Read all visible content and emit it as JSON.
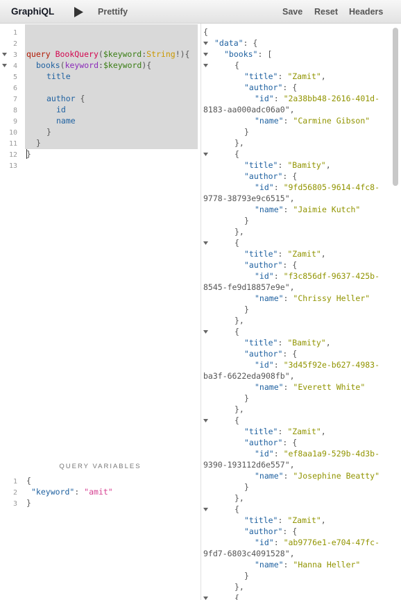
{
  "toolbar": {
    "app_title": "GraphiQL",
    "execute_icon": "play-icon",
    "prettify_label": "Prettify",
    "save_label": "Save",
    "reset_label": "Reset",
    "headers_label": "Headers"
  },
  "query_editor": {
    "line_numbers": [
      "1",
      "2",
      "3",
      "4",
      "5",
      "6",
      "7",
      "8",
      "9",
      "10",
      "11",
      "12",
      "13"
    ],
    "lines": {
      "l3_kw": "query",
      "l3_def": "BookQuery",
      "l3_p1": "(",
      "l3_var": "$keyword",
      "l3_colon": ":",
      "l3_type": "String",
      "l3_p2": "!){",
      "l4_field": "books",
      "l4_p1": "(",
      "l4_arg": "keyword",
      "l4_colon": ":",
      "l4_var": "$keyword",
      "l4_p2": "){",
      "l5_field": "title",
      "l7_field": "author",
      "l7_p": " {",
      "l8_field": "id",
      "l9_field": "name",
      "l10": "}",
      "l11": "}",
      "l12": "}"
    }
  },
  "variables": {
    "title": "QUERY VARIABLES",
    "line_numbers": [
      "1",
      "2",
      "3"
    ],
    "l1": "{",
    "l2_key": "\"keyword\"",
    "l2_colon": ": ",
    "l2_val": "\"amit\"",
    "l3": "}"
  },
  "result": {
    "open_brace": "{",
    "data_key": "\"data\"",
    "books_key": "\"books\"",
    "title_key": "\"title\"",
    "author_key": "\"author\"",
    "id_key": "\"id\"",
    "name_key": "\"name\"",
    "books": [
      {
        "title": "\"Zamit\"",
        "id_a": "\"2a38bb48-2616-401d-",
        "id_b": "8183-aa000adc06a0\"",
        "name": "\"Carmine Gibson\""
      },
      {
        "title": "\"Bamity\"",
        "id_a": "\"9fd56805-9614-4fc8-",
        "id_b": "9778-38793e9c6515\"",
        "name": "\"Jaimie Kutch\""
      },
      {
        "title": "\"Zamit\"",
        "id_a": "\"f3c856df-9637-425b-",
        "id_b": "8545-fe9d18857e9e\"",
        "name": "\"Chrissy Heller\""
      },
      {
        "title": "\"Bamity\"",
        "id_a": "\"3d45f92e-b627-4983-",
        "id_b": "ba3f-6622eda908fb\"",
        "name": "\"Everett White\""
      },
      {
        "title": "\"Zamit\"",
        "id_a": "\"ef8aa1a9-529b-4d3b-",
        "id_b": "9390-193112d6e557\"",
        "name": "\"Josephine Beatty\""
      },
      {
        "title": "\"Zamit\"",
        "id_a": "\"ab9776e1-e704-47fc-",
        "id_b": "9fd7-6803c4091528\"",
        "name": "\"Hanna Heller\""
      }
    ]
  }
}
